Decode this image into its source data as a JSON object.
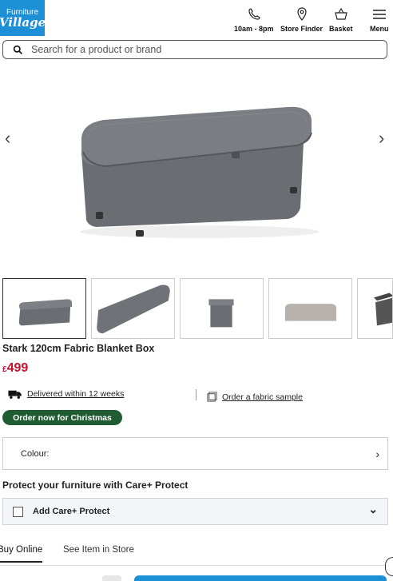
{
  "header": {
    "logo_line1": "Furniture",
    "logo_line2": "Village",
    "nav": [
      {
        "label": "10am - 8pm",
        "icon": "phone-icon"
      },
      {
        "label": "Store Finder",
        "icon": "location-pin-icon"
      },
      {
        "label": "Basket",
        "icon": "basket-icon"
      },
      {
        "label": "Menu",
        "icon": "hamburger-menu-icon"
      }
    ]
  },
  "search": {
    "placeholder": "Search for a product or brand"
  },
  "gallery": {
    "prev_arrow": "‹",
    "next_arrow": "›",
    "thumbnails": [
      "thumb-1",
      "thumb-2",
      "thumb-3",
      "thumb-4",
      "thumb-5"
    ],
    "selected_index": 0
  },
  "product": {
    "title": "Stark 120cm Fabric Blanket Box",
    "currency": "£",
    "price": "499",
    "delivery": "Delivered within 12 weeks",
    "fabric_sample": "Order a fabric sample",
    "badge": "Order now for Christmas"
  },
  "options": {
    "colour_label": "Colour:",
    "colour_chevron": "›"
  },
  "protect": {
    "heading": "Protect your furniture with Care+ Protect",
    "add_label": "Add Care+ Protect",
    "chevron": "⌄",
    "checked": false
  },
  "tabs": {
    "buy_online": "Buy Online",
    "see_in_store": "See Item in Store",
    "active": "buy_online"
  },
  "colors": {
    "brand_blue": "#1c8fd6",
    "price_red": "#c8102e",
    "badge_green": "#1f5c32",
    "fabric_grey": "#6f7175"
  }
}
